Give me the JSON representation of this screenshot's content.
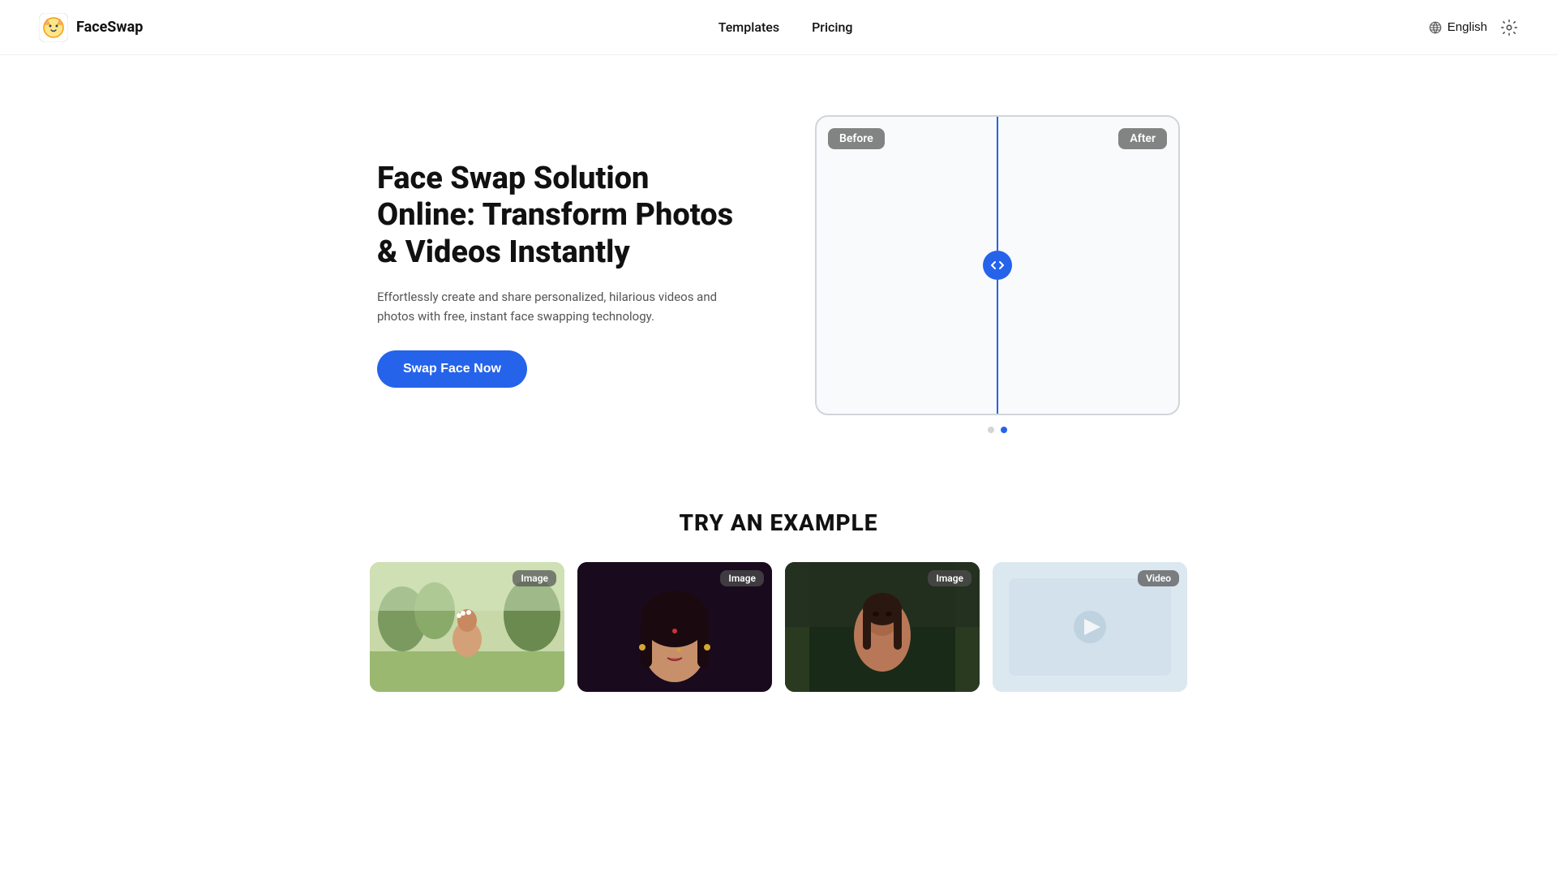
{
  "header": {
    "logo_text": "FaceSwap",
    "nav": {
      "templates_label": "Templates",
      "pricing_label": "Pricing"
    },
    "language_label": "English",
    "settings_title": "Settings"
  },
  "hero": {
    "title": "Face Swap Solution Online: Transform Photos & Videos Instantly",
    "description": "Effortlessly create and share personalized, hilarious videos and photos with free, instant face swapping technology.",
    "cta_label": "Swap Face Now",
    "compare": {
      "before_label": "Before",
      "after_label": "After"
    },
    "dots": [
      {
        "active": false
      },
      {
        "active": true
      }
    ]
  },
  "examples": {
    "section_title": "TRY AN EXAMPLE",
    "cards": [
      {
        "badge": "Image",
        "alt": "Woman in field"
      },
      {
        "badge": "Image",
        "alt": "Indian woman portrait"
      },
      {
        "badge": "Image",
        "alt": "Woman in forest"
      },
      {
        "badge": "Video",
        "alt": "Video example"
      }
    ]
  }
}
